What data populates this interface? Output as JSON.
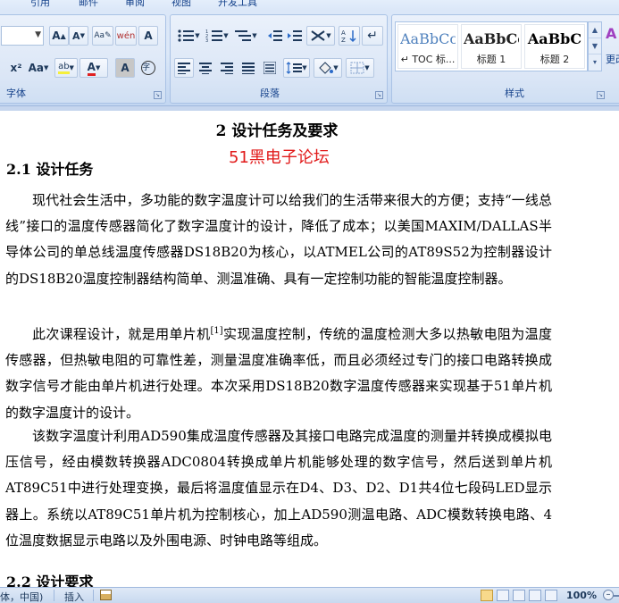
{
  "ribbon": {
    "tabs": [
      "引用",
      "邮件",
      "审阅",
      "视图",
      "开发工具"
    ],
    "groups": {
      "font": {
        "label": "字体",
        "row1": [
          "A˄",
          "A˅",
          "Aá",
          "́́",
          "A"
        ],
        "row2_x2": "x²",
        "row2_aa": "Aa"
      },
      "paragraph": {
        "label": "段落"
      },
      "styles": {
        "label": "样式",
        "items": [
          {
            "sample": "AaBbCc",
            "name": "↵ TOC 标..."
          },
          {
            "sample": "AaBbCc",
            "name": "标题 1"
          },
          {
            "sample": "AaBbC",
            "name": "标题 2"
          }
        ],
        "more_label": "更改"
      }
    }
  },
  "document": {
    "title": "2  设计任务及要求",
    "watermark": "51黑电子论坛",
    "section1": "2.1   设计任务",
    "para1": "现代社会生活中，多功能的数字温度计可以给我们的生活带来很大的方便；支持“一线总线”接口的温度传感器简化了数字温度计的设计，降低了成本；以美国MAXIM/DALLAS半导体公司的单总线温度传感器DS18B20为核心，以ATMEL公司的AT89S52为控制器设计的DS18B20温度控制器结构简单、测温准确、具有一定控制功能的智能温度控制器。",
    "para2_a": "此次课程设计，就是用单片机",
    "para2_ref": "[1]",
    "para2_b": "实现温度控制，传统的温度检测大多以热敏电阻为温度传感器，但热敏电阻的可靠性差，测量温度准确率低，而且必须经过专门的接口电路转换成数字信号才能由单片机进行处理。本次采用DS18B20数字温度传感器来实现基于51单片机的数字温度计的设计。",
    "para3": "该数字温度计利用AD590集成温度传感器及其接口电路完成温度的测量并转换成模拟电压信号，经由模数转换器ADC0804转换成单片机能够处理的数字信号，然后送到单片机AT89C51中进行处理变换，最后将温度值显示在D4、D3、D2、D1共4位七段码LED显示器上。系统以AT89C51单片机为控制核心，加上AD590测温电路、ADC模数转换电路、4位温度数据显示电路以及外围电源、时钟电路等组成。",
    "section2": "2.2  设计要求"
  },
  "statusbar": {
    "language": "体，中国)",
    "insert_mode": "插入",
    "zoom": "100%"
  }
}
